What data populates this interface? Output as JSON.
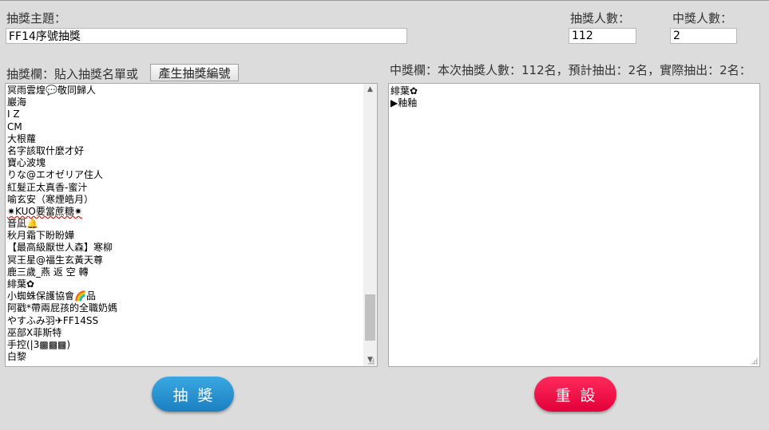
{
  "header": {
    "topic_label": "抽獎主題：",
    "topic_value": "FF14序號抽獎",
    "count_label": "抽獎人數：",
    "count_value": "112",
    "winners_label": "中獎人數：",
    "winners_value": "2"
  },
  "draw_pool": {
    "label": "抽獎欄：貼入抽獎名單或",
    "generate_button": "產生抽獎編號",
    "entries": [
      "冥雨雲煌💬敬同歸人",
      "巖海",
      "I Z",
      "CM",
      "大根蘿",
      "名字該取什麼才好",
      "寶心波塊",
      "りな@エオゼリア住人",
      "紅髮正太真香-蜜汁",
      "喻玄安（寒煙皓月）",
      "✷KUO要當蔗糖✷",
      "音凪🔔",
      "秋月霜下盼盼嬅",
      "【最高級厭世人森】寒柳",
      "冥王星@福生玄黃天尊",
      "鹿三歲_燕 返 空 轉",
      "緋葉✿",
      "小蜘蛛保護協會🌈品",
      "阿戳*帶兩屁孩的全職奶媽",
      "やすふみ羽✈FF14SS",
      "巫部X菲斯特",
      "手控(|3▩▩▩)",
      "白黎"
    ]
  },
  "winner_pool": {
    "label": "中獎欄：本次抽獎人數：112名，預計抽出：2名，實際抽出：2名：",
    "entries": [
      "緋葉✿",
      "▶釉釉"
    ]
  },
  "actions": {
    "draw_label": "抽獎",
    "reset_label": "重設"
  },
  "colors": {
    "background": "#dcdcdc",
    "draw_button": "#1b7fc0",
    "reset_button": "#e2003a"
  }
}
